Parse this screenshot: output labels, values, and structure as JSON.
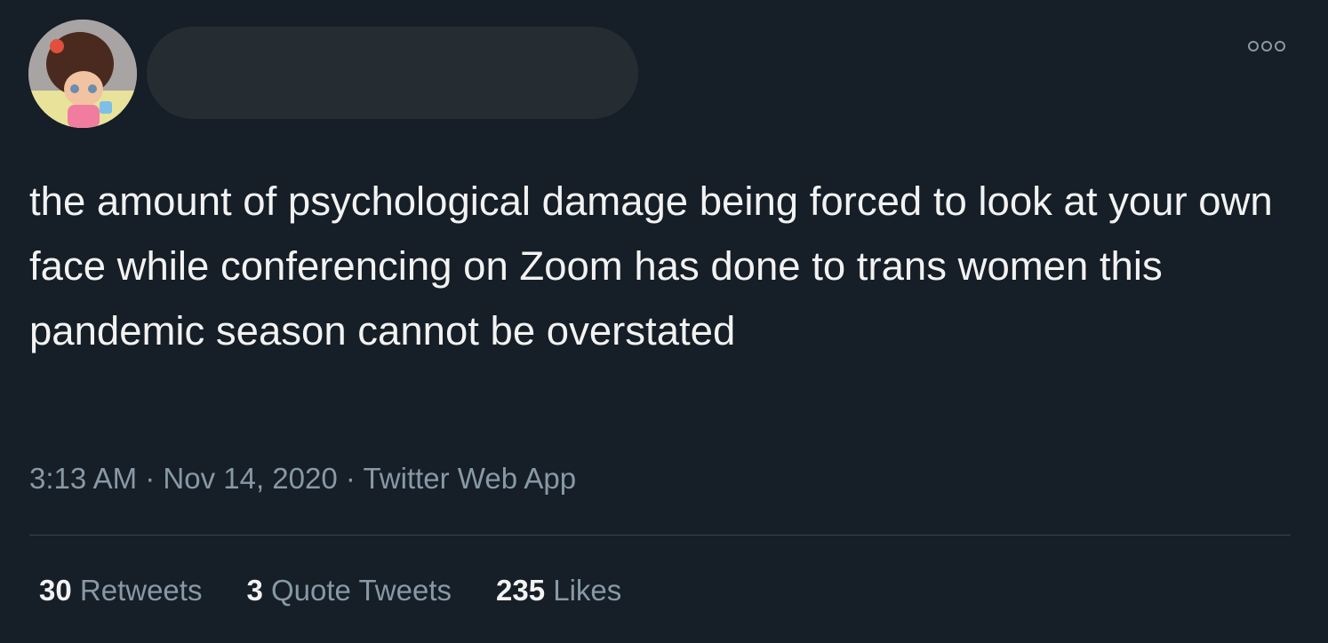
{
  "tweet": {
    "text": "the amount of psychological damage being forced to look at your own face while conferencing on Zoom has done to trans women this pandemic season cannot be overstated",
    "time": "3:13 AM",
    "date": "Nov 14, 2020",
    "source": "Twitter Web App",
    "separator": " · "
  },
  "stats": [
    {
      "count": "30",
      "label": "Retweets"
    },
    {
      "count": "3",
      "label": "Quote Tweets"
    },
    {
      "count": "235",
      "label": "Likes"
    }
  ],
  "icons": {
    "more": "more-horizontal-icon"
  },
  "colors": {
    "background": "#161e27",
    "muted": "#8899a6",
    "redaction": "#262d32"
  }
}
